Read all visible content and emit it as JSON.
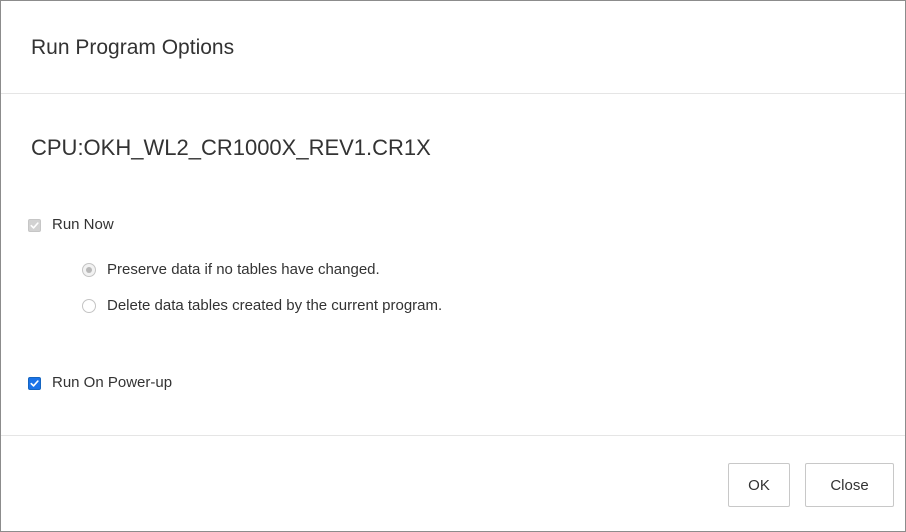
{
  "dialog": {
    "title": "Run Program Options",
    "device_name": "CPU:OKH_WL2_CR1000X_REV1.CR1X",
    "options": {
      "run_now": {
        "label": "Run Now",
        "checked": true,
        "disabled": true
      },
      "preserve_data": {
        "label": "Preserve data if no tables have changed.",
        "selected": true,
        "disabled": true
      },
      "delete_data": {
        "label": "Delete data tables created by the current program.",
        "selected": false,
        "disabled": true
      },
      "run_on_power_up": {
        "label": "Run On Power-up",
        "checked": true,
        "disabled": false
      }
    },
    "buttons": {
      "ok_label": "OK",
      "close_label": "Close"
    }
  },
  "colors": {
    "accent": "#1a73e8",
    "text": "#333333",
    "divider": "#e5e5e5",
    "disabled": "#d2d2d2"
  }
}
